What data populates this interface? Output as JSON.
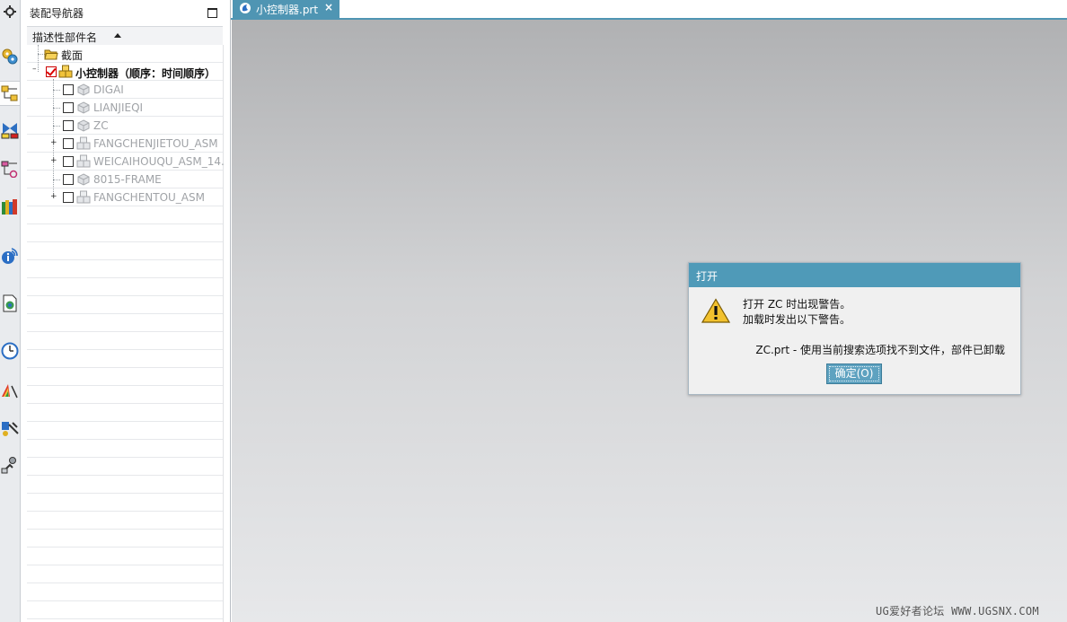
{
  "resource_bar": {
    "icons": [
      "settings-gear-icon",
      "assembly-gears-icon",
      "assembly-navigator-icon",
      "constraint-navigator-icon",
      "part-navigator-icon",
      "reuse-library-icon",
      "info-icon",
      "web-browser-icon",
      "history-icon",
      "visualization-icon",
      "process-studio-icon",
      "roles-icon"
    ]
  },
  "navigator": {
    "title": "装配导航器",
    "column_header": "描述性部件名",
    "rows": [
      {
        "label": "截面",
        "kind": "folder"
      },
      {
        "label": "小控制器（顺序：时间顺序）",
        "kind": "root-assembly",
        "checked": true
      },
      {
        "label": "DIGAI",
        "kind": "part"
      },
      {
        "label": "LIANJIEQI",
        "kind": "part"
      },
      {
        "label": "ZC",
        "kind": "part"
      },
      {
        "label": "FANGCHENJIETOU_ASM",
        "kind": "subassembly"
      },
      {
        "label": "WEICAIHOUQU_ASM_14.",
        "kind": "subassembly"
      },
      {
        "label": "8015-FRAME",
        "kind": "part"
      },
      {
        "label": "FANGCHENTOU_ASM",
        "kind": "subassembly"
      }
    ]
  },
  "tabs": [
    {
      "label": "小控制器.prt",
      "close": "×"
    }
  ],
  "dialog": {
    "title": "打开",
    "message_line1": "打开 ZC 时出现警告。",
    "message_line2": "加载时发出以下警告。",
    "detail": "ZC.prt - 使用当前搜索选项找不到文件，部件已卸载",
    "ok_label": "确定(O)"
  },
  "watermark": "UG爱好者论坛 WWW.UGSNX.COM",
  "colors": {
    "accent": "#4f9ab8",
    "tab": "#4f95b3",
    "error_check": "#d00000"
  }
}
